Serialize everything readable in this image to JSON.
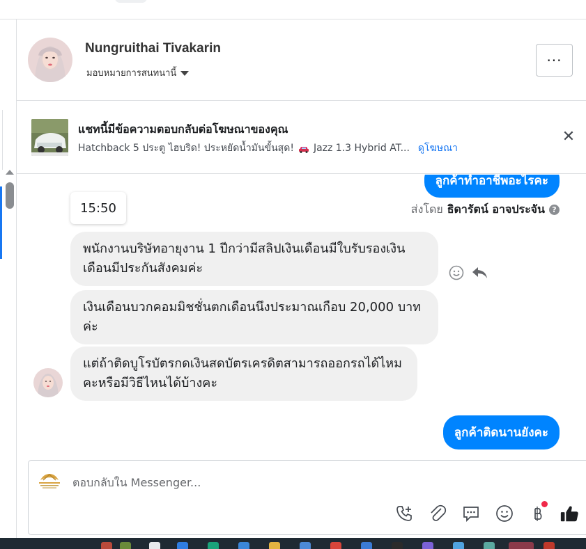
{
  "header": {
    "contact_name": "Nungruithai Tivakarin",
    "assign_label": "มอบหมายการสนทนานี้",
    "more_label": "···"
  },
  "ad_banner": {
    "title": "แชทนี้มีข้อความตอบกลับต่อโฆษณาของคุณ",
    "subtitle": "Hatchback 5 ประตู ไฮบริด! ประหยัดน้ำมันขั้นสุด!",
    "car_text": "Jazz 1.3 Hybrid AT...",
    "link_label": "ดูโฆษณา",
    "close_label": "✕"
  },
  "messages": {
    "outgoing_top": "ลูกค้าทำอาชีพอะไรคะ",
    "time_chip": "15:50",
    "sent_by_prefix": "ส่งโดย",
    "sent_by_name": "ธิดารัตน์ อาจประจัน",
    "incoming": [
      {
        "text": "พนักงานบริษัทอายุงาน 1 ปีกว่ามีสลิปเงินเดือนมีใบรับรองเงินเดือนมีประกันสังคมค่ะ"
      },
      {
        "text": "เงินเดือนบวกคอมมิชชั่นตกเดือนนึงประมาณเกือบ 20,000 บาทค่ะ"
      },
      {
        "text": "แต่ถ้าติดบูโรบัตรกดเงินสดบัตรเครดิตสามารถออกรถได้ไหมคะหรือมีวิธีไหนได้บ้างคะ"
      }
    ],
    "outgoing_bottom": "ลูกค้าติดนานยังคะ"
  },
  "composer": {
    "placeholder": "ตอบกลับใน Messenger..."
  },
  "colors": {
    "accent": "#0084ff",
    "link": "#1877f2",
    "incoming_bubble": "#f0f0f0",
    "notification": "#f02849"
  },
  "icons": {
    "tools": [
      "call-add-icon",
      "paperclip-icon",
      "saved-replies-icon",
      "emoji-icon",
      "baht-icon",
      "thumbs-up-icon"
    ],
    "message_actions": [
      "react-icon",
      "reply-icon"
    ]
  }
}
